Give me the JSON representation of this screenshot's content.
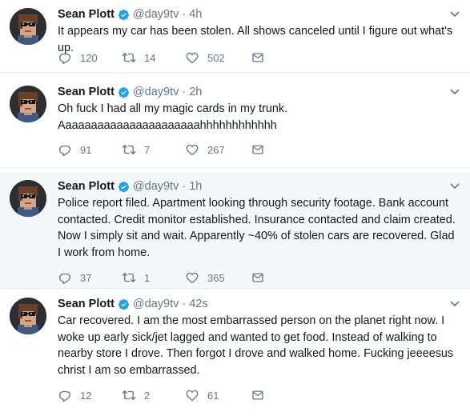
{
  "tweets": [
    {
      "name": "Sean Plott",
      "handle": "@day9tv",
      "time": "4h",
      "text": "It appears my car has been stolen.  All shows canceled until I figure out what's up.",
      "replies": "120",
      "retweets": "14",
      "likes": "502"
    },
    {
      "name": "Sean Plott",
      "handle": "@day9tv",
      "time": "2h",
      "text": "Oh fuck I had all my magic cards in my trunk.\nAaaaaaaaaaaaaaaaaaaaaahhhhhhhhhhhh",
      "replies": "91",
      "retweets": "7",
      "likes": "267"
    },
    {
      "name": "Sean Plott",
      "handle": "@day9tv",
      "time": "1h",
      "text": "Police report filed.  Apartment looking through security footage.  Bank account contacted.  Credit monitor established.  Insurance contacted and claim created.  Now I simply sit and wait.  Apparently ~40% of stolen cars are recovered.  Glad I work from home.",
      "replies": "37",
      "retweets": "1",
      "likes": "365"
    },
    {
      "name": "Sean Plott",
      "handle": "@day9tv",
      "time": "42s",
      "text": "Car recovered.  I am the most embarrassed person on the planet right now.  I woke up early sick/jet lagged and wanted to get food.  Instead of walking to nearby store I drove.  Then forgot I drove and walked home.  Fucking jeeeesus christ I am so embarrassed.",
      "replies": "12",
      "retweets": "2",
      "likes": "61"
    }
  ],
  "icons": {
    "verified": "verified-badge-icon",
    "caret": "chevron-down-icon",
    "reply": "reply-icon",
    "retweet": "retweet-icon",
    "like": "heart-icon",
    "dm": "envelope-icon"
  },
  "colors": {
    "verified": "#1da1f2",
    "meta": "#657786",
    "highlight_bg": "#f5f8fa",
    "divider": "#e6ecf0"
  }
}
